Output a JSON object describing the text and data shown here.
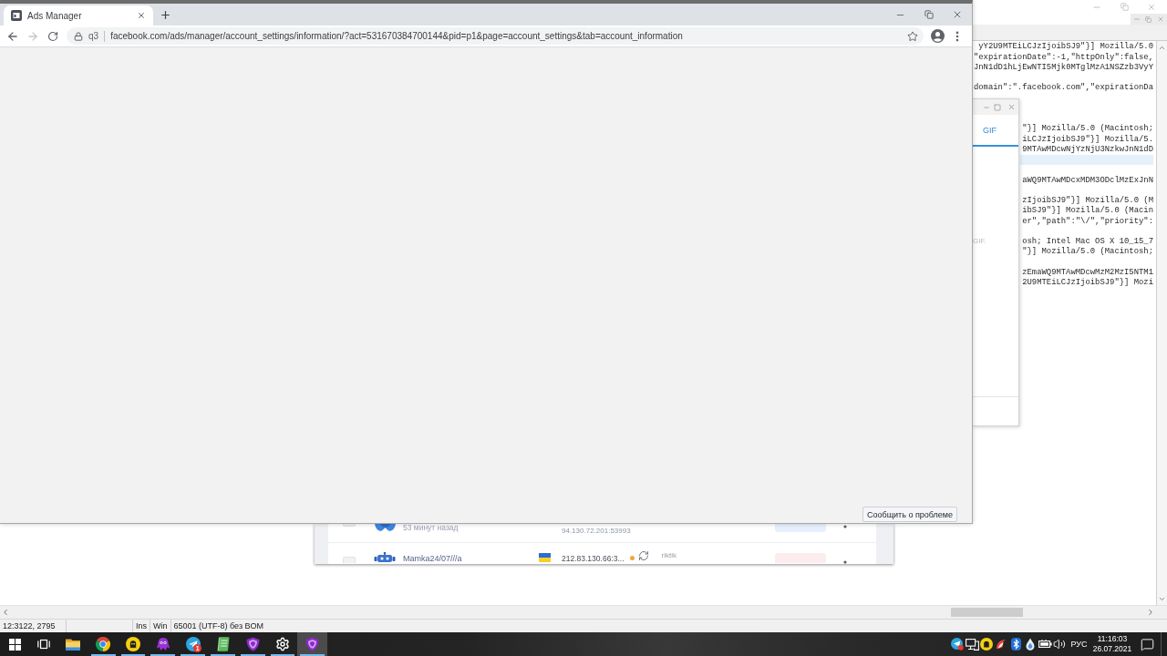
{
  "browser": {
    "tabs": [
      {
        "title": "Ads Manager",
        "selected": true
      }
    ],
    "navigation": {
      "back_disabled": false,
      "forward_disabled": true
    },
    "address_bar": {
      "chip": "q3",
      "url": "facebook.com/ads/manager/account_settings/information/?act=531670384700144&pid=p1&page=account_settings&tab=account_information",
      "bookmarked": false
    },
    "report_button": "Сообщить о проблеме"
  },
  "editor": {
    "lines": [
      {
        "kind": "text",
        "text": "yY2U9MTEiLCJzIjoibSJ9\"}] Mozilla/5.0",
        "current": false
      },
      {
        "kind": "text",
        "text": "\"expirationDate\":-1,\"httpOnly\":false,",
        "current": false
      },
      {
        "kind": "text",
        "text": "JnN1dD1hLjEwNTI5Mjk0MTglMzA1NSZzb3VyY",
        "current": false
      },
      {
        "kind": "blank",
        "current": false
      },
      {
        "kind": "text",
        "text": "domain\":\".facebook.com\",\"expirationDa",
        "current": false
      },
      {
        "kind": "blank",
        "current": false
      },
      {
        "kind": "blank",
        "current": false
      },
      {
        "kind": "blank",
        "current": false
      },
      {
        "kind": "text",
        "text": "\"}] Mozilla/5.0 (Macintosh;",
        "current": false
      },
      {
        "kind": "text",
        "text": "iLCJzIjoibSJ9\"}] Mozilla/5.",
        "current": false
      },
      {
        "kind": "text",
        "text": "9MTAwMDcwNjYzNjU3NzkwJnN1dD",
        "current": false
      },
      {
        "kind": "blank",
        "current": true
      },
      {
        "kind": "blank",
        "current": false
      },
      {
        "kind": "text",
        "text": "aWQ9MTAwMDcxMDM3ODclMzExJnN",
        "current": false
      },
      {
        "kind": "blank",
        "current": false
      },
      {
        "kind": "text",
        "text": "zIjoibSJ9\"}] Mozilla/5.0 (M",
        "current": false
      },
      {
        "kind": "text",
        "text": "ibSJ9\"}] Mozilla/5.0 (Macin",
        "current": false
      },
      {
        "kind": "text",
        "text": "er\",\"path\":\"\\/\",\"priority\":",
        "current": false
      },
      {
        "kind": "blank",
        "current": false
      },
      {
        "kind": "text",
        "text": "osh; Intel Mac OS X 10_15_7",
        "current": false
      },
      {
        "kind": "text",
        "text": "\"}] Mozilla/5.0 (Macintosh;",
        "current": false
      },
      {
        "kind": "blank",
        "current": false
      },
      {
        "kind": "text",
        "text": "zEmaWQ9MTAwMDcwMzM2MzI5NTM1",
        "current": false
      },
      {
        "kind": "text",
        "text": "2U9MTEiLCJzIjoibSJ9\"}] Mozi",
        "current": false
      }
    ],
    "status_bar": {
      "cursor": "12:3122, 2795",
      "insert_mode": "Ins",
      "line_breaks": "Win",
      "encoding": "65001 (UTF-8) без BOM"
    }
  },
  "gif_window": {
    "tabs": [
      {
        "label": "GIF",
        "selected": true
      }
    ],
    "message": "GIF."
  },
  "table_window": {
    "rows": [
      {
        "kind": "tail",
        "checked": false,
        "subtitle": "53 минут назад",
        "address": "94.130.72.201:53993",
        "badge": {
          "color": "#e7f0fc"
        }
      },
      {
        "kind": "head",
        "checked": false,
        "name": "Mamka24/07///a",
        "address": "212.83.130.66:3...",
        "status": {
          "color": "#f2a541"
        },
        "tag": "riktik",
        "badge": {
          "color": "#fdeced"
        }
      }
    ]
  },
  "taskbar": {
    "apps": [
      {
        "kind": "folder",
        "running": false,
        "selected": false
      },
      {
        "kind": "browser",
        "running": true,
        "selected": false
      },
      {
        "kind": "ghost",
        "running": true,
        "selected": false
      },
      {
        "kind": "creature",
        "running": true,
        "selected": false
      },
      {
        "kind": "messenger",
        "running": true,
        "selected": false,
        "badge": "1"
      },
      {
        "kind": "notepad",
        "running": true,
        "selected": false
      },
      {
        "kind": "shield",
        "running": true,
        "selected": false
      },
      {
        "kind": "settings",
        "running": true,
        "selected": false
      },
      {
        "kind": "shield",
        "running": true,
        "selected": true
      }
    ],
    "tray": {
      "language": "РУС",
      "time": "11:16:03",
      "date": "26.07.2021"
    }
  }
}
